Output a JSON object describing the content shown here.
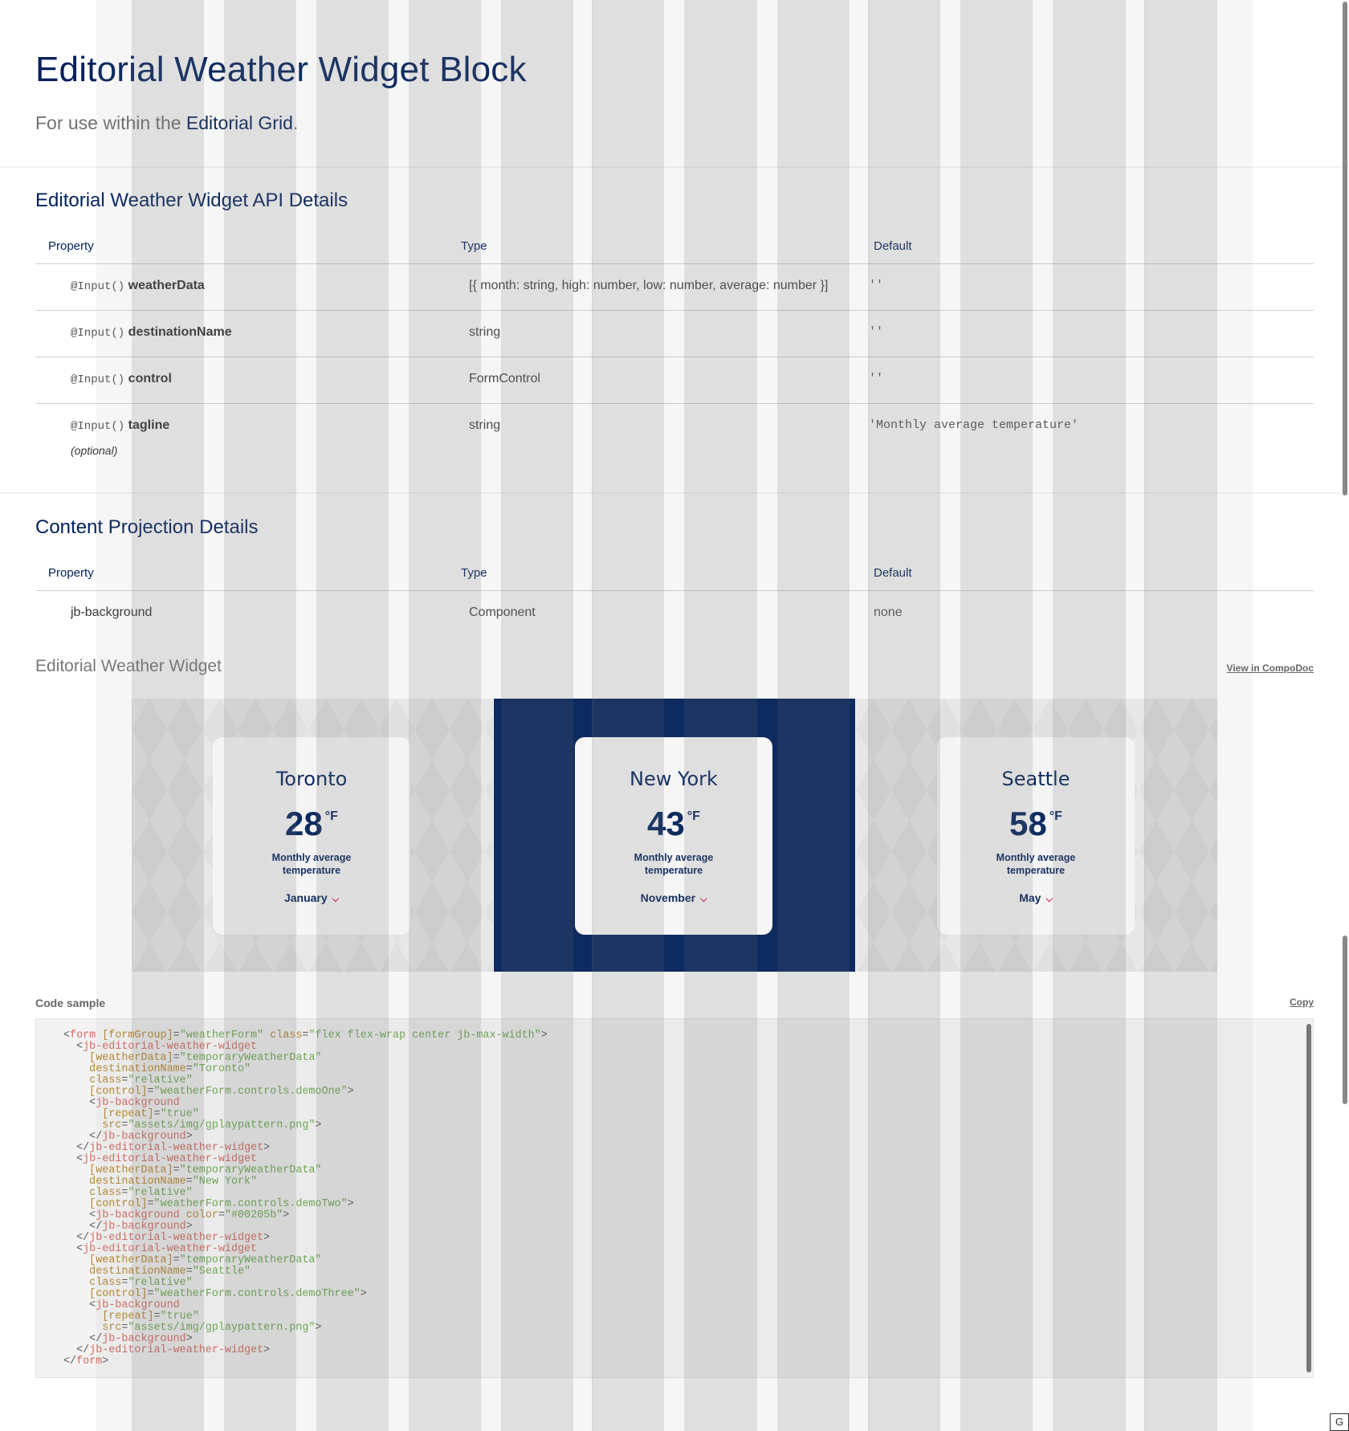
{
  "header": {
    "title": "Editorial Weather Widget Block",
    "subtitle_prefix": "For use within the ",
    "subtitle_link": "Editorial Grid",
    "subtitle_suffix": "."
  },
  "api_section": {
    "title": "Editorial Weather Widget API Details",
    "columns": [
      "Property",
      "Type",
      "Default"
    ],
    "rows": [
      {
        "decorator": "@Input()",
        "name": "weatherData",
        "optional": "",
        "type": "[{ month: string, high: number, low: number, average: number }]",
        "default": "''"
      },
      {
        "decorator": "@Input()",
        "name": "destinationName",
        "optional": "",
        "type": "string",
        "default": "''"
      },
      {
        "decorator": "@Input()",
        "name": "control",
        "optional": "",
        "type": "FormControl",
        "default": "''"
      },
      {
        "decorator": "@Input()",
        "name": "tagline",
        "optional": "(optional)",
        "type": "string",
        "default": "'Monthly average temperature'"
      }
    ]
  },
  "projection_section": {
    "title": "Content Projection Details",
    "columns": [
      "Property",
      "Type",
      "Default"
    ],
    "rows": [
      {
        "name": "jb-background",
        "type": "Component",
        "default": "none"
      }
    ]
  },
  "example": {
    "title": "Editorial Weather Widget",
    "compodoc_link": "View in CompoDoc",
    "widgets": [
      {
        "city": "Toronto",
        "temperature": "28",
        "unit": "°F",
        "tagline": "Monthly average temperature",
        "month": "January",
        "background": "pattern"
      },
      {
        "city": "New York",
        "temperature": "43",
        "unit": "°F",
        "tagline": "Monthly average temperature",
        "month": "November",
        "background": "#00205b"
      },
      {
        "city": "Seattle",
        "temperature": "58",
        "unit": "°F",
        "tagline": "Monthly average temperature",
        "month": "May",
        "background": "pattern"
      }
    ]
  },
  "code_sample": {
    "label": "Code sample",
    "copy_label": "Copy"
  },
  "colors": {
    "brand_navy": "#00205b",
    "accent_red": "#d50032",
    "code_tag": "#d5685e",
    "code_attr": "#b8862e",
    "code_string": "#6aa84f"
  },
  "corner_button": "G"
}
